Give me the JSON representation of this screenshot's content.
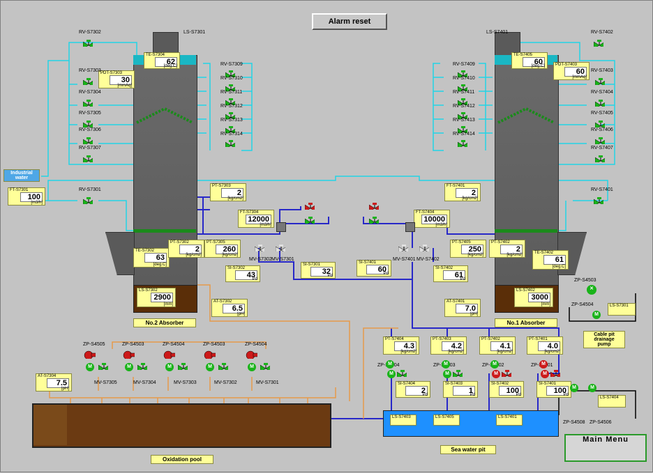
{
  "buttons": {
    "alarm_reset": "Alarm reset",
    "main_menu": "Main Menu"
  },
  "labels": {
    "industrial_water": "Industrial water",
    "no2_absorber": "No.2 Absorber",
    "no1_absorber": "No.1 Absorber",
    "oxidation_pool": "Oxidation pool",
    "sea_water_pit": "Sea water pit",
    "cable_pit_pump": "Cable pit drainage pump"
  },
  "panels": {
    "pdt_s7303": {
      "tag": "PDT-S7303",
      "value": "30",
      "unit": "[mmAq]"
    },
    "te_s7304": {
      "tag": "TE-S7304",
      "value": "62",
      "unit": "[deg.C]"
    },
    "ft_s7301": {
      "tag": "FT-S7301",
      "value": "100",
      "unit": "[m3/h]"
    },
    "pt_s7303": {
      "tag": "PT-S7303",
      "value": "2",
      "unit": "[kg/cm2]"
    },
    "ft_s7304": {
      "tag": "FT-S7304",
      "value": "12000",
      "unit": "[m3/h]"
    },
    "te_s7302": {
      "tag": "TE-S7302",
      "value": "63",
      "unit": "[deg.C]"
    },
    "pt_s7302": {
      "tag": "PT-S7302",
      "value": "2",
      "unit": "[kg/cm2]"
    },
    "pt_s7305": {
      "tag": "PT-S7305",
      "value": "260",
      "unit": "[kg/cm2]"
    },
    "si_s7302": {
      "tag": "SI-S7302",
      "value": "43",
      "unit": "Pd"
    },
    "si_s7301": {
      "tag": "SI-S7301",
      "value": "32",
      "unit": "Pd"
    },
    "ls_s7302": {
      "tag": "LS-S7302",
      "value": "2900",
      "unit": "[mm]"
    },
    "at_s7302": {
      "tag": "AT-S7302",
      "value": "6.5",
      "unit": "[pH]"
    },
    "pdt_s7403": {
      "tag": "PDT-S7403",
      "value": "60",
      "unit": "[mmAq]"
    },
    "te_s7405": {
      "tag": "TE-S7405",
      "value": "60",
      "unit": "[deg.C]"
    },
    "ft_s7401": {
      "tag": "FT-S7401",
      "value": "2",
      "unit": "[kg/cm2]"
    },
    "ft_s7404": {
      "tag": "FT-S7404",
      "value": "10000",
      "unit": "[m3/h]"
    },
    "pt_s7405": {
      "tag": "PT-S7405",
      "value": "250",
      "unit": "[kg/cm2]"
    },
    "pt_s7402": {
      "tag": "PT-S7402",
      "value": "2",
      "unit": "[kg/cm2]"
    },
    "te_s7402": {
      "tag": "TE-S7402",
      "value": "61",
      "unit": "[deg.C]"
    },
    "si_s7401": {
      "tag": "SI-S7401",
      "value": "60",
      "unit": "Pd"
    },
    "si_s7402": {
      "tag": "SI-S7402",
      "value": "61",
      "unit": "Pd"
    },
    "ls_s7402": {
      "tag": "LS-S7402",
      "value": "3000",
      "unit": "[mm]"
    },
    "at_s7401": {
      "tag": "AT-S7401",
      "value": "7.0",
      "unit": "[pH]"
    },
    "at_s7304": {
      "tag": "AT-S7304",
      "value": "7.5",
      "unit": "[pH]"
    },
    "pt_s7404_a": {
      "tag": "PT-S7404",
      "value": "4.3",
      "unit": "[kg/cm2]"
    },
    "pt_s7403_a": {
      "tag": "PT-S7403",
      "value": "4.2",
      "unit": "[kg/cm2]"
    },
    "pt_s7402_a": {
      "tag": "PT-S7402",
      "value": "4.1",
      "unit": "[kg/cm2]"
    },
    "pt_s7401_a": {
      "tag": "PT-S7401",
      "value": "4.0",
      "unit": "[kg/cm2]"
    },
    "si_s7404": {
      "tag": "SI-S7404",
      "value": "2",
      "unit": "Pd"
    },
    "si_s7403": {
      "tag": "SI-S7403",
      "value": "1",
      "unit": "Pd"
    },
    "si_s7402b": {
      "tag": "SI-S7402",
      "value": "100",
      "unit": "Pd"
    },
    "si_s7401b": {
      "tag": "SI-S7401",
      "value": "100",
      "unit": "Pd"
    },
    "ls_s7403": {
      "tag": "LS-S7403",
      "value": "",
      "unit": ""
    },
    "ls_s7405": {
      "tag": "LS-S7405",
      "value": "",
      "unit": ""
    },
    "ls_s7401": {
      "tag": "LS-S7401",
      "value": "",
      "unit": ""
    },
    "ls_s7404": {
      "tag": "LS-S7404",
      "value": "",
      "unit": ""
    },
    "ls_s7301": {
      "tag": "LS-S7301",
      "value": "",
      "unit": ""
    }
  },
  "tags": {
    "rv_s7302_a": "RV-S7302",
    "ls_s7301_top": "LS-S7301",
    "rv_s7303": "RV-S7303",
    "rv_s7304": "RV-S7304",
    "rv_s7305": "RV-S7305",
    "rv_s7306": "RV-S7306",
    "rv_s7307": "RV-S7307",
    "rv_s7301": "RV-S7301",
    "rv_s7309": "RV-S7309",
    "rv_s7310": "RV-S7310",
    "rv_s7311": "RV-S7311",
    "rv_s7312": "RV-S7312",
    "rv_s7313": "RV-S7313",
    "rv_s7314": "RV-S7314",
    "rv_s7401_top": "LS-S7401",
    "rv_s7402": "RV-S7402",
    "rv_s7403": "RV-S7403",
    "rv_s7409": "RV-S7409",
    "rv_s7410": "RV-S7410",
    "rv_s7411": "RV-S7411",
    "rv_s7412": "RV-S7412",
    "rv_s7413": "RV-S7413",
    "rv_s7414": "RV-S7414",
    "rv_s7404": "RV-S7404",
    "rv_s7405": "RV-S7405",
    "rv_s7406": "RV-S7406",
    "rv_s7407": "RV-S7407",
    "rv_s7401": "RV-S7401",
    "mv_s7302": "MV-S7302",
    "mv_s7301": "MV-S7301",
    "mv_s7401": "MV-S7401",
    "mv_s7402": "MV-S7402",
    "zp_s4505": "ZP-S4505",
    "zp_s4503": "ZP-S4503",
    "zp_s4504": "ZP-S4504",
    "mv_s7305": "MV-S7305",
    "mv_s7304": "MV-S7304",
    "mv_s7303": "MV-S7303",
    "mv_s7302b": "MV-S7302",
    "mv_s7301b": "MV-S7301",
    "zp_s4404": "ZP-S4404",
    "zp_s4403": "ZP-S4403",
    "zp_s4402": "ZP-S4402",
    "zp_s4401": "ZP-S4401",
    "zp_s4508": "ZP-S4508",
    "zp_s4506": "ZP-S4506"
  },
  "colors": {
    "water_pipe": "#22d4e6",
    "slurry_pipe": "#2828c8",
    "oxid_pipe": "#e69a4a",
    "valve_green": "#19b319",
    "valve_red": "#cc1a1a"
  }
}
